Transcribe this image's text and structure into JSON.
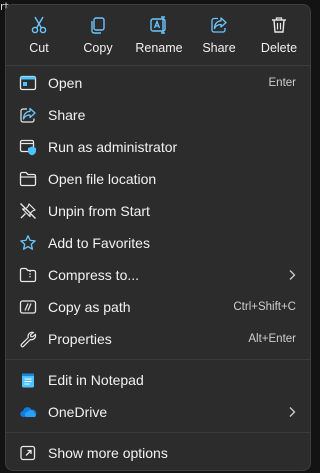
{
  "stray_text": "rt",
  "quick_actions": [
    {
      "label": "Cut",
      "icon": "scissors-icon"
    },
    {
      "label": "Copy",
      "icon": "copy-icon"
    },
    {
      "label": "Rename",
      "icon": "rename-icon"
    },
    {
      "label": "Share",
      "icon": "share-icon"
    },
    {
      "label": "Delete",
      "icon": "trash-icon"
    }
  ],
  "items": [
    {
      "label": "Open",
      "shortcut": "Enter",
      "icon": "open-window-icon"
    },
    {
      "label": "Share",
      "shortcut": "",
      "icon": "share-icon"
    },
    {
      "label": "Run as administrator",
      "shortcut": "",
      "icon": "shield-admin-icon"
    },
    {
      "label": "Open file location",
      "shortcut": "",
      "icon": "folder-icon"
    },
    {
      "label": "Unpin from Start",
      "shortcut": "",
      "icon": "unpin-icon"
    },
    {
      "label": "Add to Favorites",
      "shortcut": "",
      "icon": "star-icon"
    },
    {
      "label": "Compress to...",
      "shortcut": "",
      "icon": "zip-folder-icon",
      "submenu": true
    },
    {
      "label": "Copy as path",
      "shortcut": "Ctrl+Shift+C",
      "icon": "copy-path-icon"
    },
    {
      "label": "Properties",
      "shortcut": "Alt+Enter",
      "icon": "wrench-icon"
    },
    {
      "label": "Edit in Notepad",
      "shortcut": "",
      "icon": "notepad-icon"
    },
    {
      "label": "OneDrive",
      "shortcut": "",
      "icon": "onedrive-cloud-icon",
      "submenu": true
    },
    {
      "label": "Show more options",
      "shortcut": "",
      "icon": "external-link-icon"
    }
  ],
  "colors": {
    "menu_bg": "#2c2c2c",
    "accent_blue": "#4cc2ff",
    "onedrive_blue": "#0f7ce0",
    "text": "#f2f2f2"
  }
}
